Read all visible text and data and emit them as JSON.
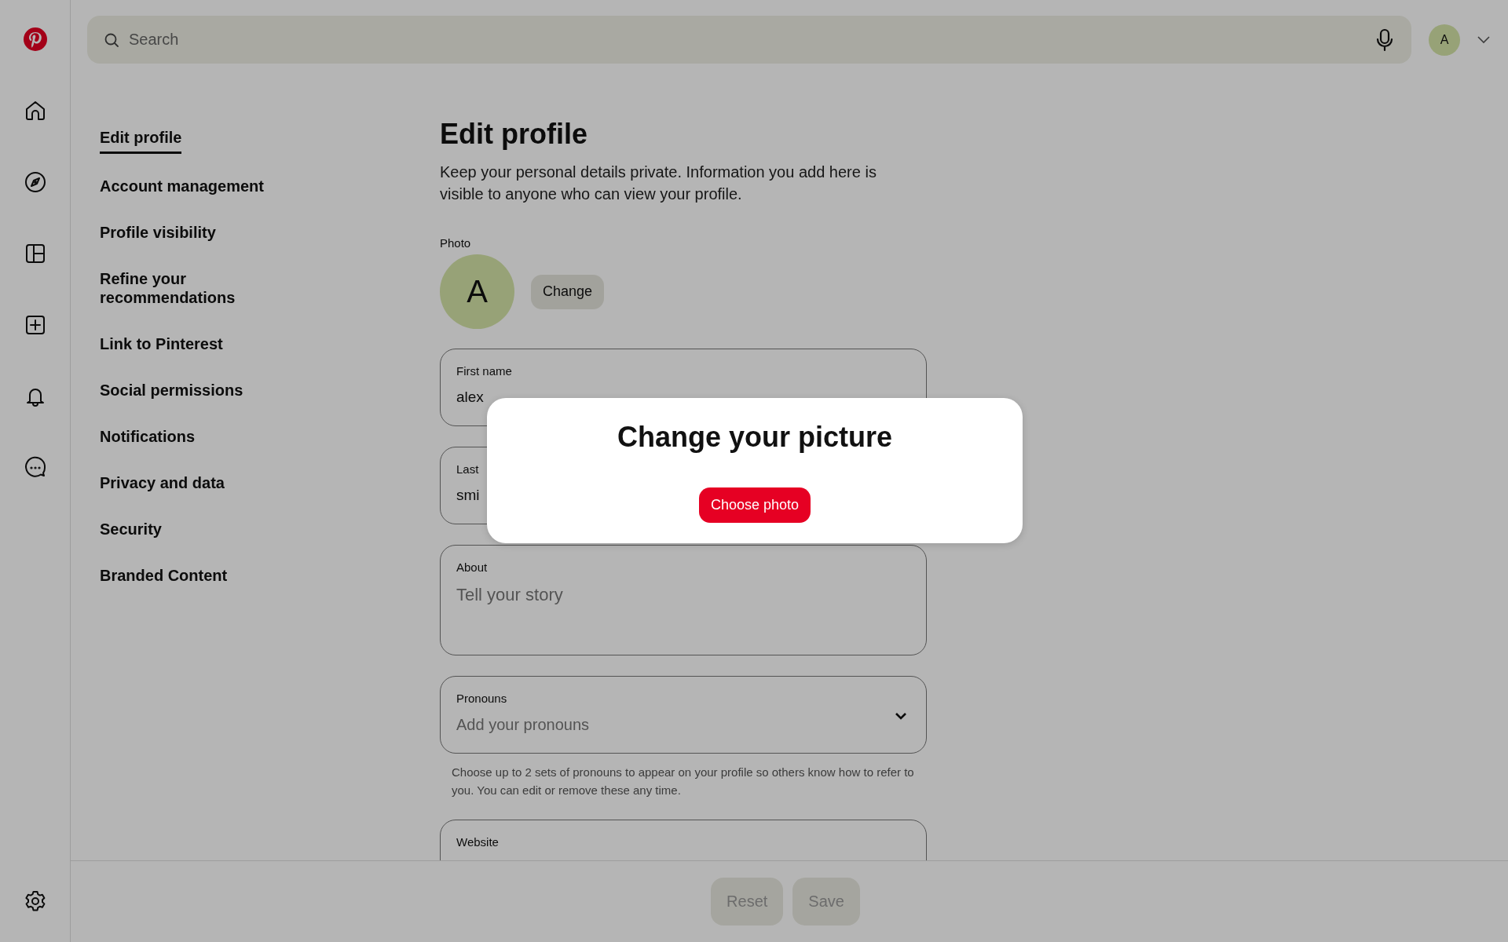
{
  "search": {
    "placeholder": "Search"
  },
  "account": {
    "avatar_letter": "A"
  },
  "settings_nav": {
    "items": [
      {
        "label": "Edit profile",
        "selected": true
      },
      {
        "label": "Account management",
        "selected": false
      },
      {
        "label": "Profile visibility",
        "selected": false
      },
      {
        "label": "Refine your recommendations",
        "selected": false
      },
      {
        "label": "Link to Pinterest",
        "selected": false
      },
      {
        "label": "Social permissions",
        "selected": false
      },
      {
        "label": "Notifications",
        "selected": false
      },
      {
        "label": "Privacy and data",
        "selected": false
      },
      {
        "label": "Security",
        "selected": false
      },
      {
        "label": "Branded Content",
        "selected": false
      }
    ]
  },
  "page": {
    "title": "Edit profile",
    "description": "Keep your personal details private. Information you add here is visible to anyone who can view your profile."
  },
  "photo": {
    "label": "Photo",
    "avatar_letter": "A",
    "button": "Change"
  },
  "fields": [
    {
      "kind": "text",
      "label": "First name",
      "value": "alex"
    },
    {
      "kind": "text",
      "label": "Last",
      "value": "smi"
    },
    {
      "kind": "textarea",
      "label": "About",
      "placeholder": "Tell your story"
    },
    {
      "kind": "select",
      "label": "Pronouns",
      "placeholder": "Add your pronouns",
      "help": "Choose up to 2 sets of pronouns to appear on your profile so others know how to refer to you. You can edit or remove these any time."
    },
    {
      "kind": "text",
      "label": "Website"
    }
  ],
  "footer": {
    "buttons": [
      {
        "label": "Reset",
        "disabled": true
      },
      {
        "label": "Save",
        "disabled": true
      }
    ]
  },
  "modal": {
    "title": "Change your picture",
    "button": "Choose photo"
  }
}
